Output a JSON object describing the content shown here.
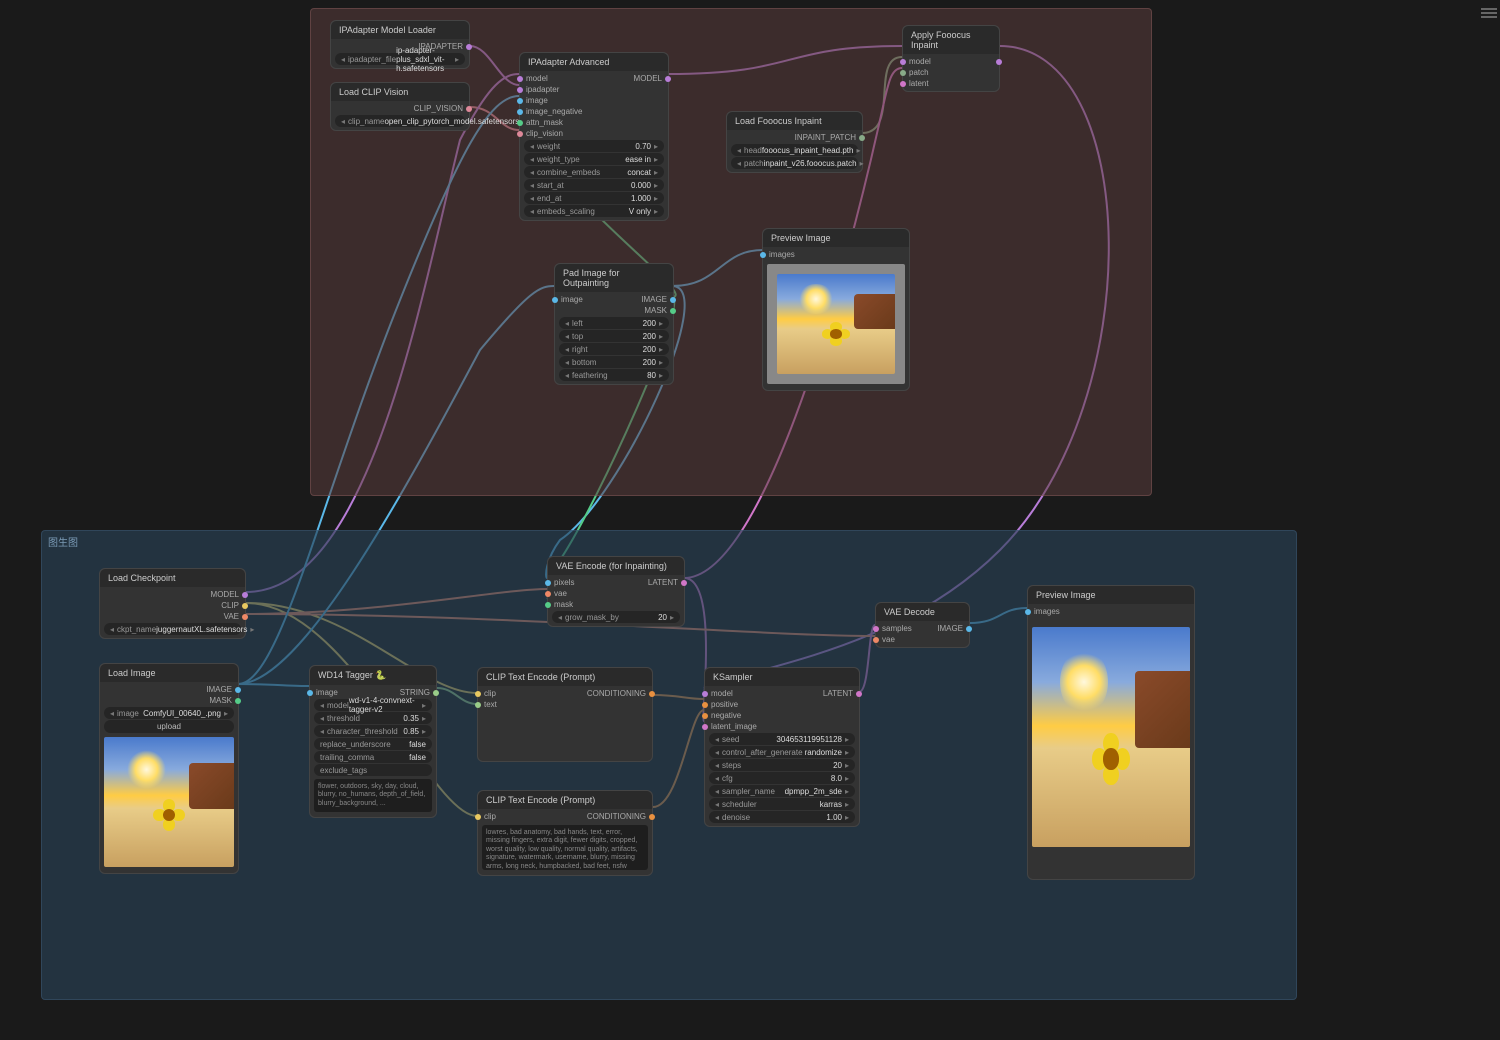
{
  "groups": {
    "bottom_label": "图生图"
  },
  "nodes": {
    "ipadapter_loader": {
      "title": "IPAdapter Model Loader",
      "out_ipadapter": "IPADAPTER",
      "widget_file_label": "ipadapter_file",
      "widget_file_value": "ip-adapter-plus_sdxl_vit-h.safetensors"
    },
    "clip_vision": {
      "title": "Load CLIP Vision",
      "out": "CLIP_VISION",
      "widget_label": "clip_name",
      "widget_value": "open_clip_pytorch_model.safetensors"
    },
    "ipadapter_adv": {
      "title": "IPAdapter Advanced",
      "in_model": "model",
      "in_ipadapter": "ipadapter",
      "in_image": "image",
      "in_image_neg": "image_negative",
      "in_attn_mask": "attn_mask",
      "in_clip_vision": "clip_vision",
      "out_model": "MODEL",
      "w_weight_l": "weight",
      "w_weight_v": "0.70",
      "w_wtype_l": "weight_type",
      "w_wtype_v": "ease in",
      "w_combine_l": "combine_embeds",
      "w_combine_v": "concat",
      "w_start_l": "start_at",
      "w_start_v": "0.000",
      "w_end_l": "end_at",
      "w_end_v": "1.000",
      "w_scale_l": "embeds_scaling",
      "w_scale_v": "V only"
    },
    "fooocus_load": {
      "title": "Load Fooocus Inpaint",
      "out_patch": "INPAINT_PATCH",
      "w_head_l": "head",
      "w_head_v": "fooocus_inpaint_head.pth",
      "w_patch_l": "patch",
      "w_patch_v": "inpaint_v26.fooocus.patch"
    },
    "fooocus_apply": {
      "title": "Apply Fooocus Inpaint",
      "in_model": "model",
      "in_patch": "patch",
      "in_latent": "latent"
    },
    "pad": {
      "title": "Pad Image for Outpainting",
      "in_image": "image",
      "out_image": "IMAGE",
      "out_mask": "MASK",
      "w_left_l": "left",
      "w_left_v": "200",
      "w_top_l": "top",
      "w_top_v": "200",
      "w_right_l": "right",
      "w_right_v": "200",
      "w_bottom_l": "bottom",
      "w_bottom_v": "200",
      "w_feather_l": "feathering",
      "w_feather_v": "80"
    },
    "preview1": {
      "title": "Preview Image",
      "in_images": "images"
    },
    "preview2": {
      "title": "Preview Image",
      "in_images": "images"
    },
    "ckpt": {
      "title": "Load Checkpoint",
      "out_model": "MODEL",
      "out_clip": "CLIP",
      "out_vae": "VAE",
      "w_l": "ckpt_name",
      "w_v": "juggernautXL.safetensors"
    },
    "load_image": {
      "title": "Load Image",
      "out_image": "IMAGE",
      "out_mask": "MASK",
      "w_l": "image",
      "w_v": "ComfyUI_00640_.png",
      "upload": "upload"
    },
    "wd14": {
      "title": "WD14 Tagger 🐍",
      "in_image": "image",
      "out": "STRING",
      "w_model_l": "model",
      "w_model_v": "wd-v1-4-convnext-tagger-v2",
      "w_thresh_l": "threshold",
      "w_thresh_v": "0.35",
      "w_cthresh_l": "character_threshold",
      "w_cthresh_v": "0.85",
      "w_under_l": "replace_underscore",
      "w_under_v": "false",
      "w_trail_l": "trailing_comma",
      "w_trail_v": "false",
      "w_excl_l": "exclude_tags",
      "tags": "flower, outdoors, sky, day, cloud, blurry, no_humans, depth_of_field, blurry_background, ..."
    },
    "clip_pos": {
      "title": "CLIP Text Encode (Prompt)",
      "in_clip": "clip",
      "in_text": "text",
      "out": "CONDITIONING"
    },
    "clip_neg": {
      "title": "CLIP Text Encode (Prompt)",
      "in_clip": "clip",
      "out": "CONDITIONING",
      "text": "lowres, bad anatomy, bad hands, text, error, missing fingers, extra digit, fewer digits, cropped, worst quality, low quality, normal quality, artifacts, signature, watermark, username, blurry, missing arms, long neck, humpbacked, bad feet, nsfw"
    },
    "vae_encode": {
      "title": "VAE Encode (for Inpainting)",
      "in_pixels": "pixels",
      "in_vae": "vae",
      "in_mask": "mask",
      "out": "LATENT",
      "w_l": "grow_mask_by",
      "w_v": "20"
    },
    "ksampler": {
      "title": "KSampler",
      "in_model": "model",
      "in_positive": "positive",
      "in_negative": "negative",
      "in_latent": "latent_image",
      "out": "LATENT",
      "w_seed_l": "seed",
      "w_seed_v": "304653119951128",
      "w_ctrl_l": "control_after_generate",
      "w_ctrl_v": "randomize",
      "w_steps_l": "steps",
      "w_steps_v": "20",
      "w_cfg_l": "cfg",
      "w_cfg_v": "8.0",
      "w_samp_l": "sampler_name",
      "w_samp_v": "dpmpp_2m_sde",
      "w_sched_l": "scheduler",
      "w_sched_v": "karras",
      "w_den_l": "denoise",
      "w_den_v": "1.00"
    },
    "vae_decode": {
      "title": "VAE Decode",
      "in_samples": "samples",
      "in_vae": "vae",
      "out": "IMAGE"
    }
  }
}
